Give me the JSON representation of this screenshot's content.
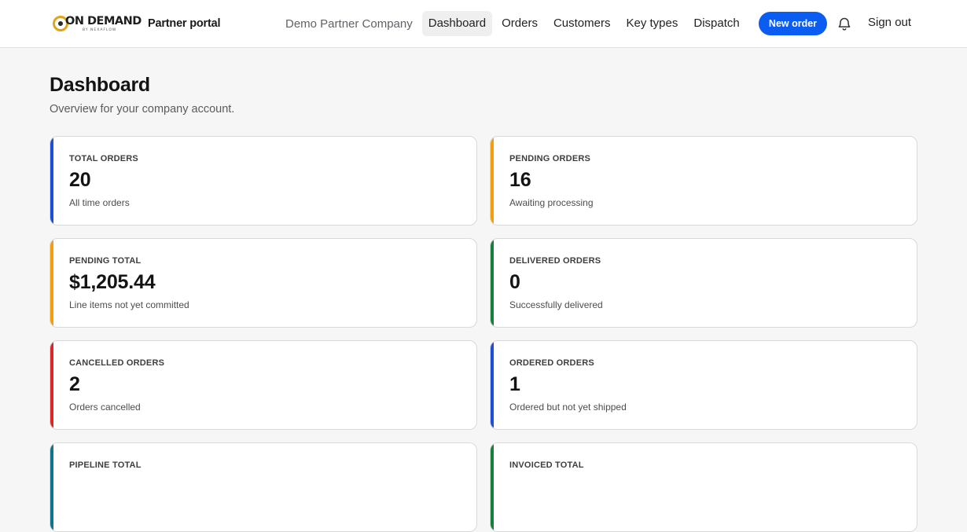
{
  "header": {
    "logo_text": "ON DEMAND",
    "logo_sub": "BY NEXAFLOW",
    "portal_label": "Partner portal",
    "company_name": "Demo Partner Company",
    "nav": [
      {
        "label": "Dashboard",
        "active": true
      },
      {
        "label": "Orders",
        "active": false
      },
      {
        "label": "Customers",
        "active": false
      },
      {
        "label": "Key types",
        "active": false
      },
      {
        "label": "Dispatch",
        "active": false
      }
    ],
    "new_order_label": "New order",
    "notifications_icon": "bell-icon",
    "sign_out_label": "Sign out"
  },
  "page": {
    "title": "Dashboard",
    "subtitle": "Overview for your company account."
  },
  "cards": [
    {
      "label": "Total orders",
      "value": "20",
      "description": "All time orders",
      "accent": "#1d4ed8"
    },
    {
      "label": "Pending orders",
      "value": "16",
      "description": "Awaiting processing",
      "accent": "#f59e0b"
    },
    {
      "label": "Pending total",
      "value": "$1,205.44",
      "description": "Line items not yet committed",
      "accent": "#f59e0b"
    },
    {
      "label": "Delivered orders",
      "value": "0",
      "description": "Successfully delivered",
      "accent": "#15803d"
    },
    {
      "label": "Cancelled orders",
      "value": "2",
      "description": "Orders cancelled",
      "accent": "#dc2626"
    },
    {
      "label": "Ordered orders",
      "value": "1",
      "description": "Ordered but not yet shipped",
      "accent": "#1d4ed8"
    },
    {
      "label": "Pipeline total",
      "value": "",
      "description": "",
      "accent": "#0e7490"
    },
    {
      "label": "Invoiced total",
      "value": "",
      "description": "",
      "accent": "#15803d"
    }
  ],
  "colors": {
    "brand_blue": "#0b5cf0",
    "logo_gold": "#e0a41a"
  }
}
